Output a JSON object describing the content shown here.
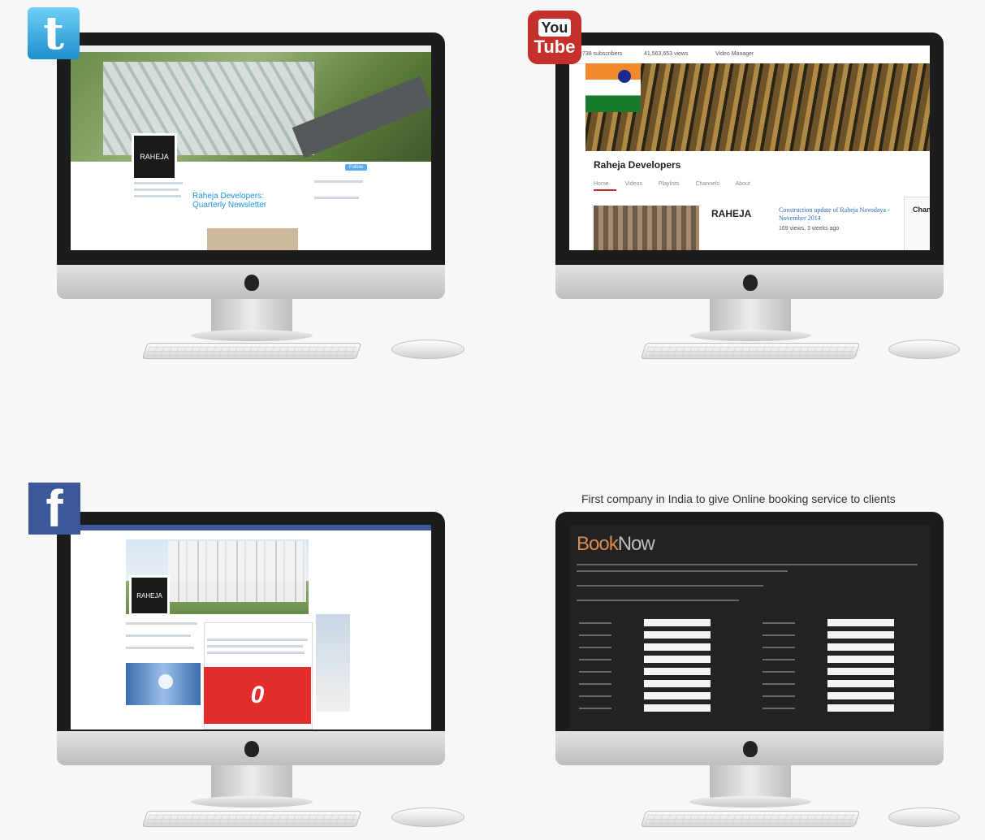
{
  "panels": {
    "twitter": {
      "badge_letter": "t",
      "avatar_text": "RAHEJA",
      "tweet_link": "Raheja Developers: Quarterly Newsletter",
      "follow_label": "Follow"
    },
    "youtube": {
      "badge_top": "You",
      "badge_bottom": "Tube",
      "subscribers": "738 subscribers",
      "views": "41,563,653 views",
      "video_manager": "Video Manager",
      "channel_name": "Raheja Developers",
      "tabs": "Home Videos Playlists Channels About",
      "video_brand": "RAHEJA",
      "video_title": "Construction update of Raheja Navodaya - November 2014",
      "video_meta": "169 views, 3 weeks ago",
      "side_title": "Channel"
    },
    "facebook": {
      "badge_letter": "f",
      "avatar_text": "RAHEJA",
      "post_logo": "0"
    },
    "booking": {
      "caption": "First company in India to give Online booking service to clients",
      "title_part1": "Book",
      "title_part2": "Now"
    }
  },
  "colors": {
    "twitter_blue": "#1d8fcb",
    "youtube_red": "#c4302b",
    "facebook_blue": "#3b5998",
    "booking_orange": "#d98a51"
  },
  "icons": [
    "twitter-logo-icon",
    "youtube-logo-icon",
    "facebook-logo-icon",
    "apple-logo-icon"
  ]
}
